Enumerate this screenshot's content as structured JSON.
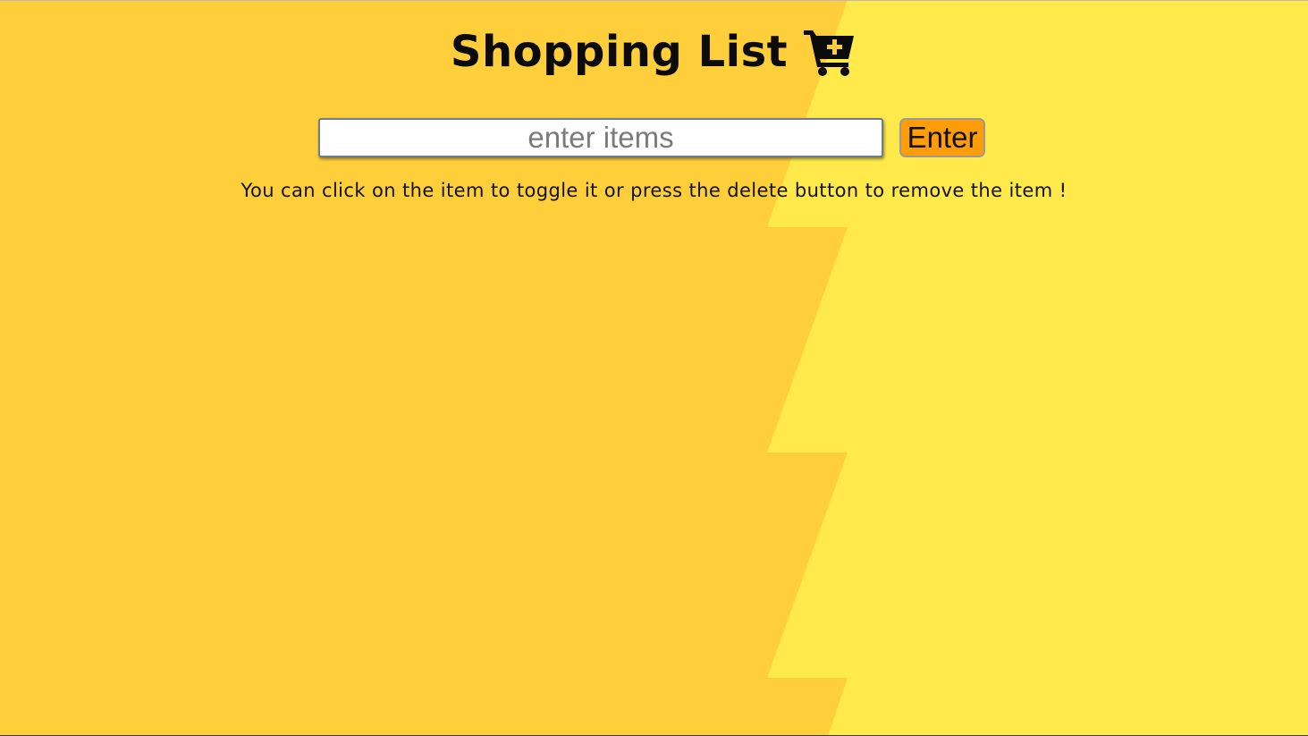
{
  "header": {
    "title": "Shopping List",
    "icon": "cart-plus-icon"
  },
  "form": {
    "input_placeholder": "enter items",
    "input_value": "",
    "enter_label": "Enter"
  },
  "hint": {
    "text": "You can click on the item to toggle it or press the delete button to remove the item !"
  },
  "colors": {
    "background_left": "#fecf3a",
    "background_right": "#ffe94b",
    "button": "#ff9c0a",
    "text": "#0b0b0b"
  }
}
